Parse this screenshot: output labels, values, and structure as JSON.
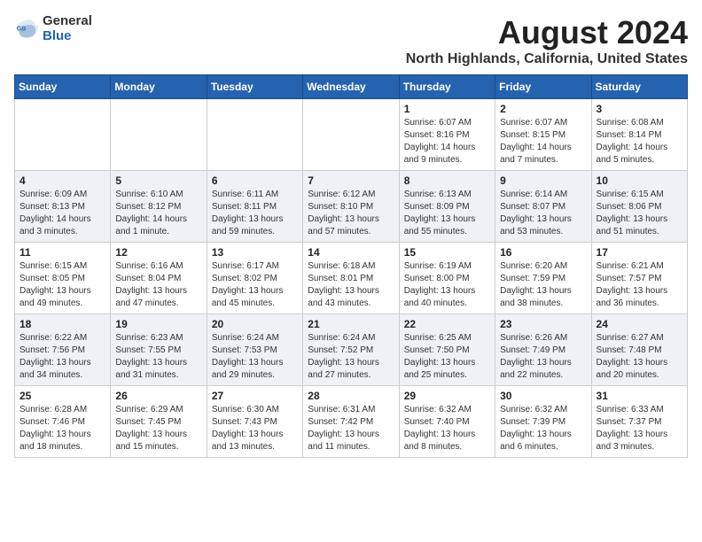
{
  "logo": {
    "general": "General",
    "blue": "Blue"
  },
  "title": "August 2024",
  "subtitle": "North Highlands, California, United States",
  "days_of_week": [
    "Sunday",
    "Monday",
    "Tuesday",
    "Wednesday",
    "Thursday",
    "Friday",
    "Saturday"
  ],
  "weeks": [
    [
      {
        "num": "",
        "info": ""
      },
      {
        "num": "",
        "info": ""
      },
      {
        "num": "",
        "info": ""
      },
      {
        "num": "",
        "info": ""
      },
      {
        "num": "1",
        "info": "Sunrise: 6:07 AM\nSunset: 8:16 PM\nDaylight: 14 hours\nand 9 minutes."
      },
      {
        "num": "2",
        "info": "Sunrise: 6:07 AM\nSunset: 8:15 PM\nDaylight: 14 hours\nand 7 minutes."
      },
      {
        "num": "3",
        "info": "Sunrise: 6:08 AM\nSunset: 8:14 PM\nDaylight: 14 hours\nand 5 minutes."
      }
    ],
    [
      {
        "num": "4",
        "info": "Sunrise: 6:09 AM\nSunset: 8:13 PM\nDaylight: 14 hours\nand 3 minutes."
      },
      {
        "num": "5",
        "info": "Sunrise: 6:10 AM\nSunset: 8:12 PM\nDaylight: 14 hours\nand 1 minute."
      },
      {
        "num": "6",
        "info": "Sunrise: 6:11 AM\nSunset: 8:11 PM\nDaylight: 13 hours\nand 59 minutes."
      },
      {
        "num": "7",
        "info": "Sunrise: 6:12 AM\nSunset: 8:10 PM\nDaylight: 13 hours\nand 57 minutes."
      },
      {
        "num": "8",
        "info": "Sunrise: 6:13 AM\nSunset: 8:09 PM\nDaylight: 13 hours\nand 55 minutes."
      },
      {
        "num": "9",
        "info": "Sunrise: 6:14 AM\nSunset: 8:07 PM\nDaylight: 13 hours\nand 53 minutes."
      },
      {
        "num": "10",
        "info": "Sunrise: 6:15 AM\nSunset: 8:06 PM\nDaylight: 13 hours\nand 51 minutes."
      }
    ],
    [
      {
        "num": "11",
        "info": "Sunrise: 6:15 AM\nSunset: 8:05 PM\nDaylight: 13 hours\nand 49 minutes."
      },
      {
        "num": "12",
        "info": "Sunrise: 6:16 AM\nSunset: 8:04 PM\nDaylight: 13 hours\nand 47 minutes."
      },
      {
        "num": "13",
        "info": "Sunrise: 6:17 AM\nSunset: 8:02 PM\nDaylight: 13 hours\nand 45 minutes."
      },
      {
        "num": "14",
        "info": "Sunrise: 6:18 AM\nSunset: 8:01 PM\nDaylight: 13 hours\nand 43 minutes."
      },
      {
        "num": "15",
        "info": "Sunrise: 6:19 AM\nSunset: 8:00 PM\nDaylight: 13 hours\nand 40 minutes."
      },
      {
        "num": "16",
        "info": "Sunrise: 6:20 AM\nSunset: 7:59 PM\nDaylight: 13 hours\nand 38 minutes."
      },
      {
        "num": "17",
        "info": "Sunrise: 6:21 AM\nSunset: 7:57 PM\nDaylight: 13 hours\nand 36 minutes."
      }
    ],
    [
      {
        "num": "18",
        "info": "Sunrise: 6:22 AM\nSunset: 7:56 PM\nDaylight: 13 hours\nand 34 minutes."
      },
      {
        "num": "19",
        "info": "Sunrise: 6:23 AM\nSunset: 7:55 PM\nDaylight: 13 hours\nand 31 minutes."
      },
      {
        "num": "20",
        "info": "Sunrise: 6:24 AM\nSunset: 7:53 PM\nDaylight: 13 hours\nand 29 minutes."
      },
      {
        "num": "21",
        "info": "Sunrise: 6:24 AM\nSunset: 7:52 PM\nDaylight: 13 hours\nand 27 minutes."
      },
      {
        "num": "22",
        "info": "Sunrise: 6:25 AM\nSunset: 7:50 PM\nDaylight: 13 hours\nand 25 minutes."
      },
      {
        "num": "23",
        "info": "Sunrise: 6:26 AM\nSunset: 7:49 PM\nDaylight: 13 hours\nand 22 minutes."
      },
      {
        "num": "24",
        "info": "Sunrise: 6:27 AM\nSunset: 7:48 PM\nDaylight: 13 hours\nand 20 minutes."
      }
    ],
    [
      {
        "num": "25",
        "info": "Sunrise: 6:28 AM\nSunset: 7:46 PM\nDaylight: 13 hours\nand 18 minutes."
      },
      {
        "num": "26",
        "info": "Sunrise: 6:29 AM\nSunset: 7:45 PM\nDaylight: 13 hours\nand 15 minutes."
      },
      {
        "num": "27",
        "info": "Sunrise: 6:30 AM\nSunset: 7:43 PM\nDaylight: 13 hours\nand 13 minutes."
      },
      {
        "num": "28",
        "info": "Sunrise: 6:31 AM\nSunset: 7:42 PM\nDaylight: 13 hours\nand 11 minutes."
      },
      {
        "num": "29",
        "info": "Sunrise: 6:32 AM\nSunset: 7:40 PM\nDaylight: 13 hours\nand 8 minutes."
      },
      {
        "num": "30",
        "info": "Sunrise: 6:32 AM\nSunset: 7:39 PM\nDaylight: 13 hours\nand 6 minutes."
      },
      {
        "num": "31",
        "info": "Sunrise: 6:33 AM\nSunset: 7:37 PM\nDaylight: 13 hours\nand 3 minutes."
      }
    ]
  ]
}
